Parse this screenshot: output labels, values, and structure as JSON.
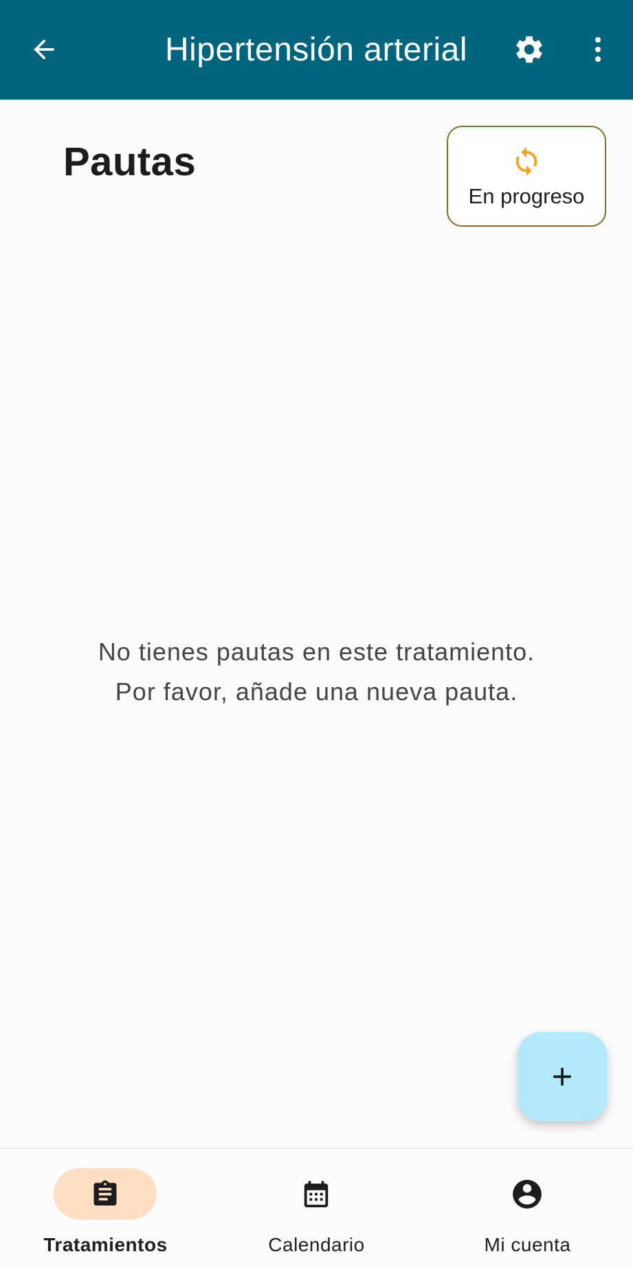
{
  "appbar": {
    "title": "Hipertensión arterial",
    "background": "#00657c",
    "back_icon": "arrow-left-icon",
    "settings_icon": "gear-icon",
    "more_icon": "more-vert-icon"
  },
  "main": {
    "heading": "Pautas",
    "status_chip": {
      "label": "En progreso",
      "icon": "sync-icon",
      "icon_color": "#f4a51f",
      "border_color": "#8a6a25"
    },
    "empty_state": {
      "line1": "No tienes pautas en este tratamiento.",
      "line2": "Por favor, añade una nueva pauta."
    },
    "fab": {
      "icon": "plus-icon",
      "background": "#b3e8fd"
    }
  },
  "bottom_nav": {
    "items": [
      {
        "label": "Tratamientos",
        "icon": "clipboard-icon",
        "active": true
      },
      {
        "label": "Calendario",
        "icon": "calendar-icon",
        "active": false
      },
      {
        "label": "Mi cuenta",
        "icon": "account-circle-icon",
        "active": false
      }
    ],
    "active_pill_color": "#ffdfc4"
  }
}
